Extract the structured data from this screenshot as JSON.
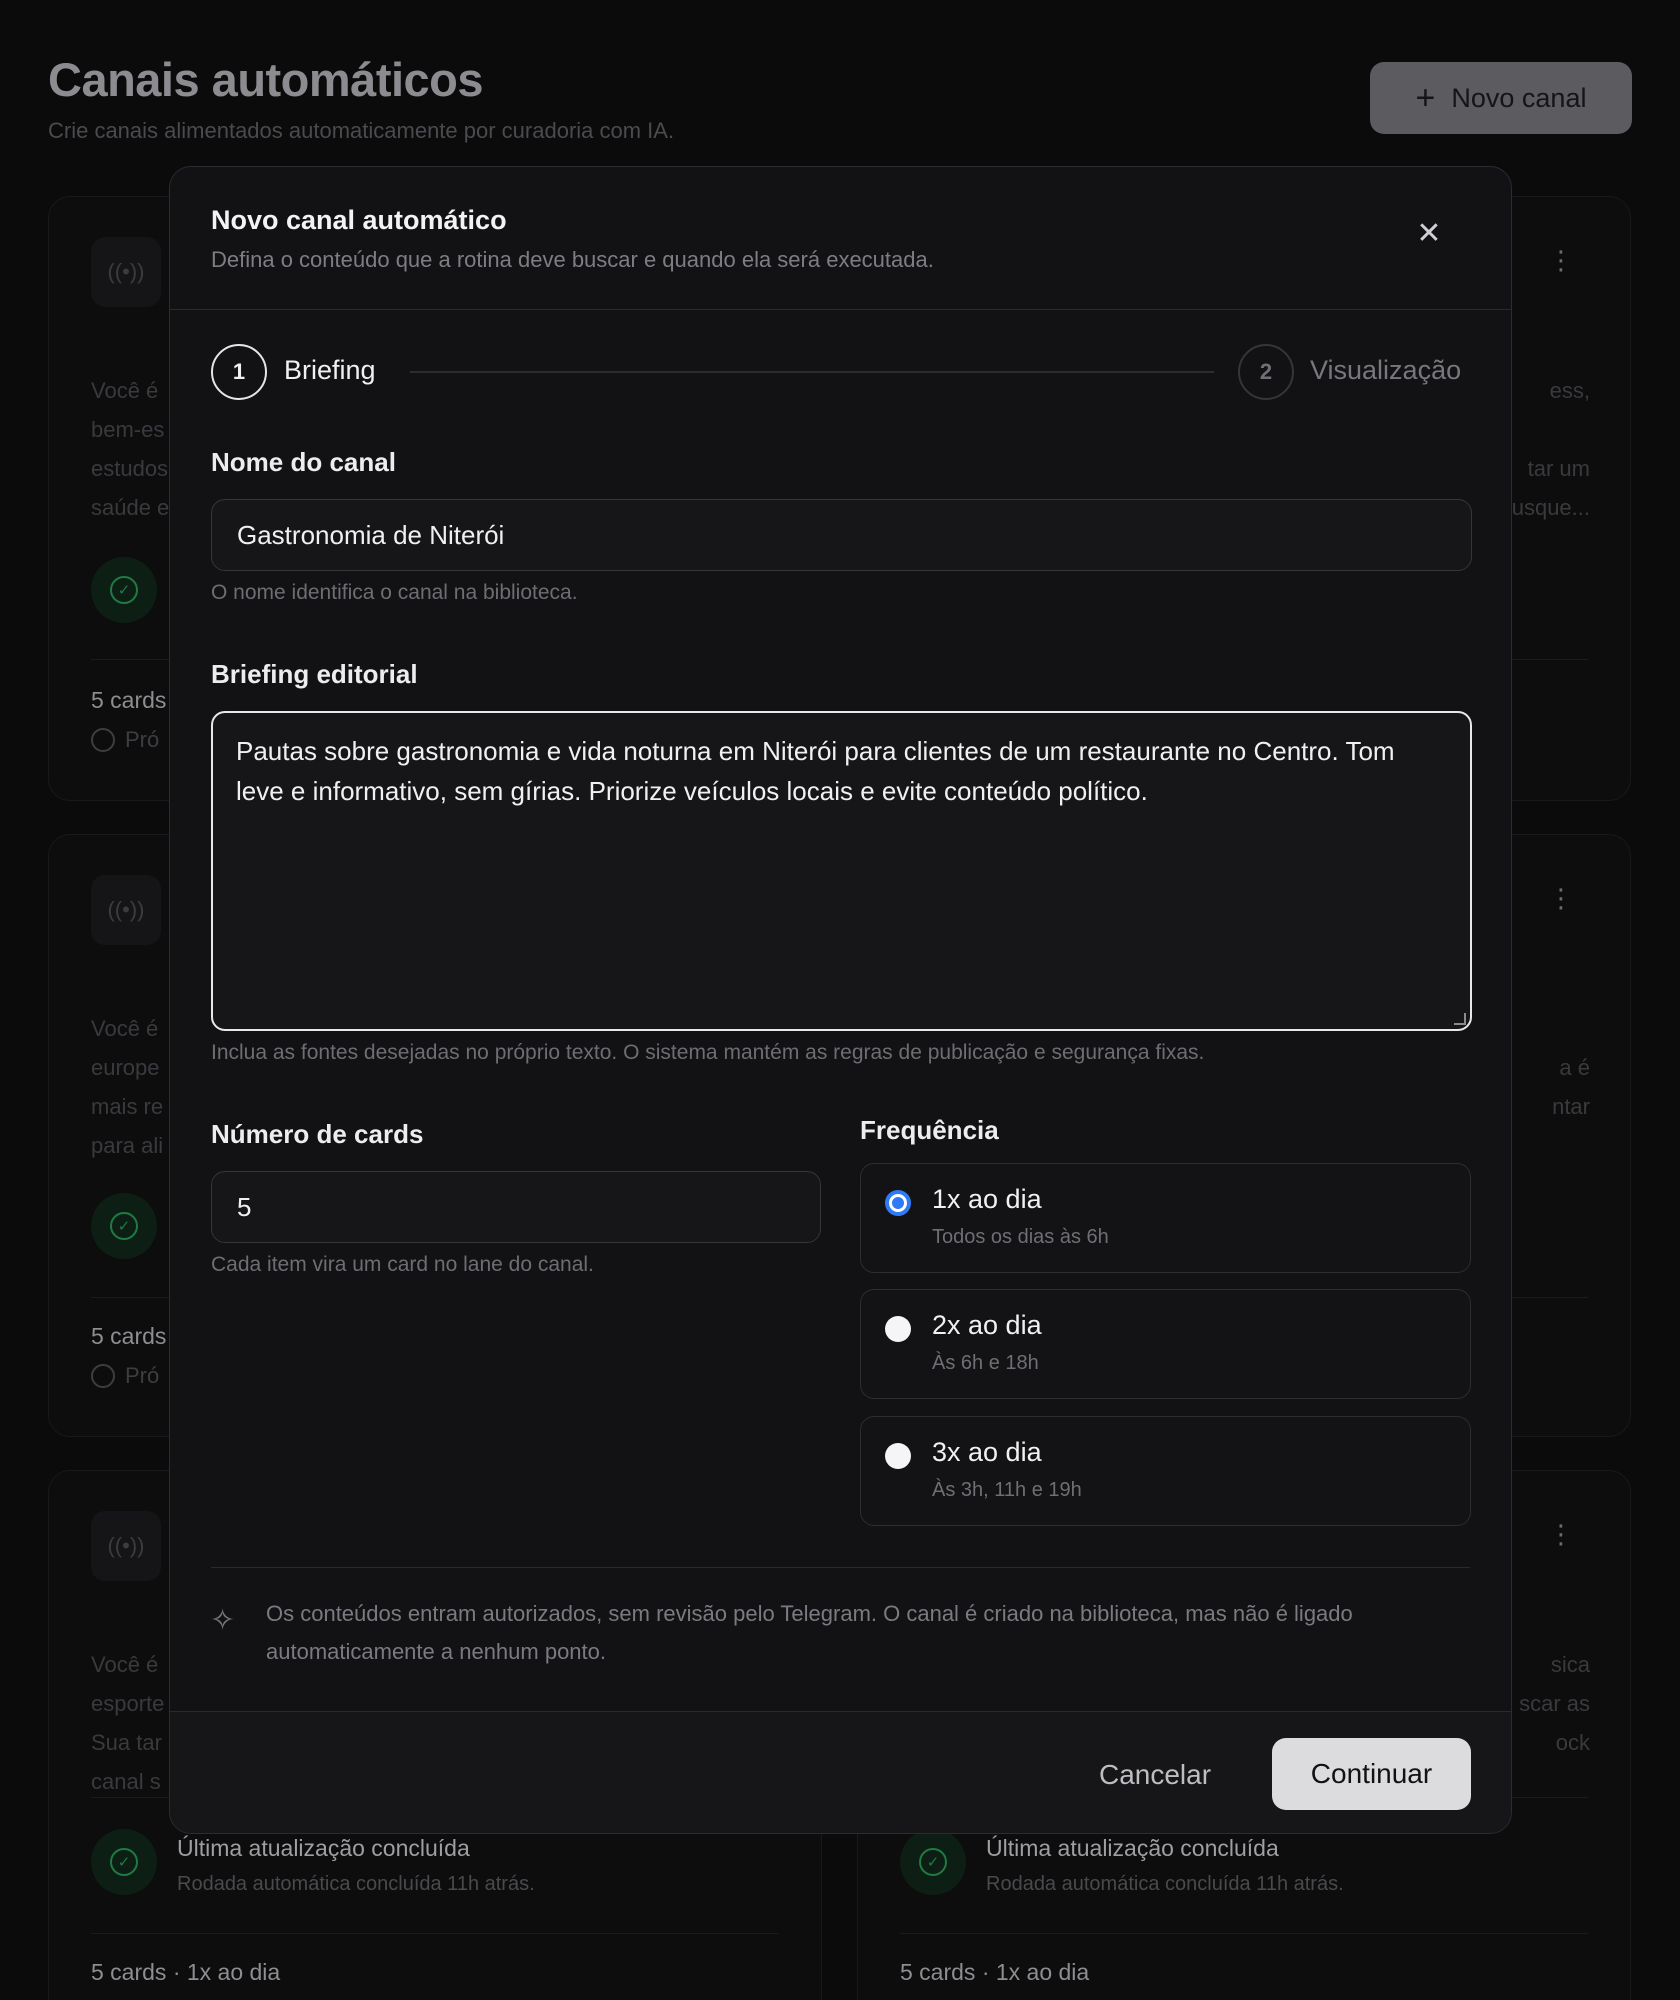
{
  "page": {
    "title": "Canais automáticos",
    "subtitle": "Crie canais alimentados automaticamente por curadoria com IA.",
    "new_channel_label": "Novo canal"
  },
  "background_cards": {
    "left_1": {
      "desc_fragments": [
        "Você é",
        "bem-es",
        "estudos",
        "saúde e"
      ],
      "meta": "5 cards",
      "next": "Pró"
    },
    "right_1": {
      "desc_fragments": [
        "ess,",
        "",
        "tar um",
        "usque..."
      ]
    },
    "left_2": {
      "desc_fragments": [
        "Você é",
        "europe",
        "mais re",
        "para ali"
      ],
      "meta": "5 cards",
      "next": "Pró"
    },
    "right_2": {
      "desc_fragments": [
        "",
        "a é",
        "ntar",
        ""
      ]
    },
    "left_3": {
      "desc_fragments": [
        "Você é",
        "esporte",
        "Sua tar",
        "canal s"
      ],
      "upd_title": "Última atualização concluída",
      "upd_sub": "Rodada automática concluída 11h atrás.",
      "meta": "5 cards · 1x ao dia"
    },
    "right_3": {
      "desc_fragments": [
        "sica",
        "scar as",
        "ock",
        ""
      ],
      "upd_title": "Última atualização concluída",
      "upd_sub": "Rodada automática concluída 11h atrás.",
      "meta": "5 cards · 1x ao dia"
    }
  },
  "modal": {
    "title": "Novo canal automático",
    "subtitle": "Defina o conteúdo que a rotina deve buscar e quando ela será executada.",
    "steps": [
      {
        "number": "1",
        "label": "Briefing",
        "active": true
      },
      {
        "number": "2",
        "label": "Visualização",
        "active": false
      }
    ],
    "name_field": {
      "label": "Nome do canal",
      "value": "Gastronomia de Niterói",
      "hint": "O nome identifica o canal na biblioteca."
    },
    "briefing_field": {
      "label": "Briefing editorial",
      "value": "Pautas sobre gastronomia e vida noturna em Niterói para clientes de um restaurante no Centro. Tom leve e informativo, sem gírias. Priorize veículos locais e evite conteúdo político.",
      "hint": "Inclua as fontes desejadas no próprio texto. O sistema mantém as regras de publicação e segurança fixas."
    },
    "cards_field": {
      "label": "Número de cards",
      "value": "5",
      "hint": "Cada item vira um card no lane do canal."
    },
    "frequency": {
      "label": "Frequência",
      "options": [
        {
          "title": "1x ao dia",
          "sub": "Todos os dias às 6h",
          "selected": true
        },
        {
          "title": "2x ao dia",
          "sub": "Às 6h e 18h",
          "selected": false
        },
        {
          "title": "3x ao dia",
          "sub": "Às 3h, 11h e 19h",
          "selected": false
        }
      ]
    },
    "notice": "Os conteúdos entram autorizados, sem revisão pelo Telegram. O canal é criado na biblioteca, mas não é ligado automaticamente a nenhum ponto.",
    "cancel_label": "Cancelar",
    "continue_label": "Continuar"
  },
  "colors": {
    "accent_radio": "#2f7bf5",
    "success": "#1f7a44",
    "primary_button": "#dcdcdf"
  },
  "icons": [
    "plus-icon",
    "signal-icon",
    "more-vertical-icon",
    "check-circle-icon",
    "clock-icon",
    "close-icon",
    "sparkle-icon"
  ]
}
